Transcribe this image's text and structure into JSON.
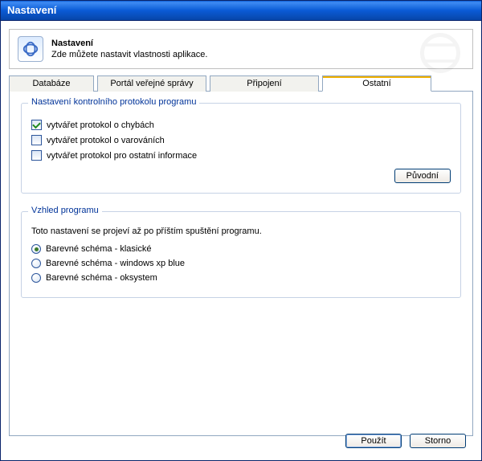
{
  "window": {
    "title": "Nastavení"
  },
  "header": {
    "title": "Nastavení",
    "subtitle": "Zde můžete nastavit vlastnosti aplikace."
  },
  "tabs": {
    "db": "Databáze",
    "portal": "Portál veřejné správy",
    "connection": "Připojení",
    "other": "Ostatní"
  },
  "group_protocol": {
    "legend": "Nastavení kontrolního protokolu programu",
    "chk_errors": "vytvářet protokol o chybách",
    "chk_warnings": "vytvářet protokol o varováních",
    "chk_info": "vytvářet protokol pro ostatní informace",
    "btn_default": "Původní"
  },
  "group_look": {
    "legend": "Vzhled programu",
    "note": "Toto nastavení se projeví až po příštím spuštění programu.",
    "radio_classic": "Barevné schéma - klasické",
    "radio_xpblue": "Barevné schéma - windows xp blue",
    "radio_oksystem": "Barevné schéma - oksystem"
  },
  "footer": {
    "apply": "Použít",
    "cancel": "Storno"
  }
}
